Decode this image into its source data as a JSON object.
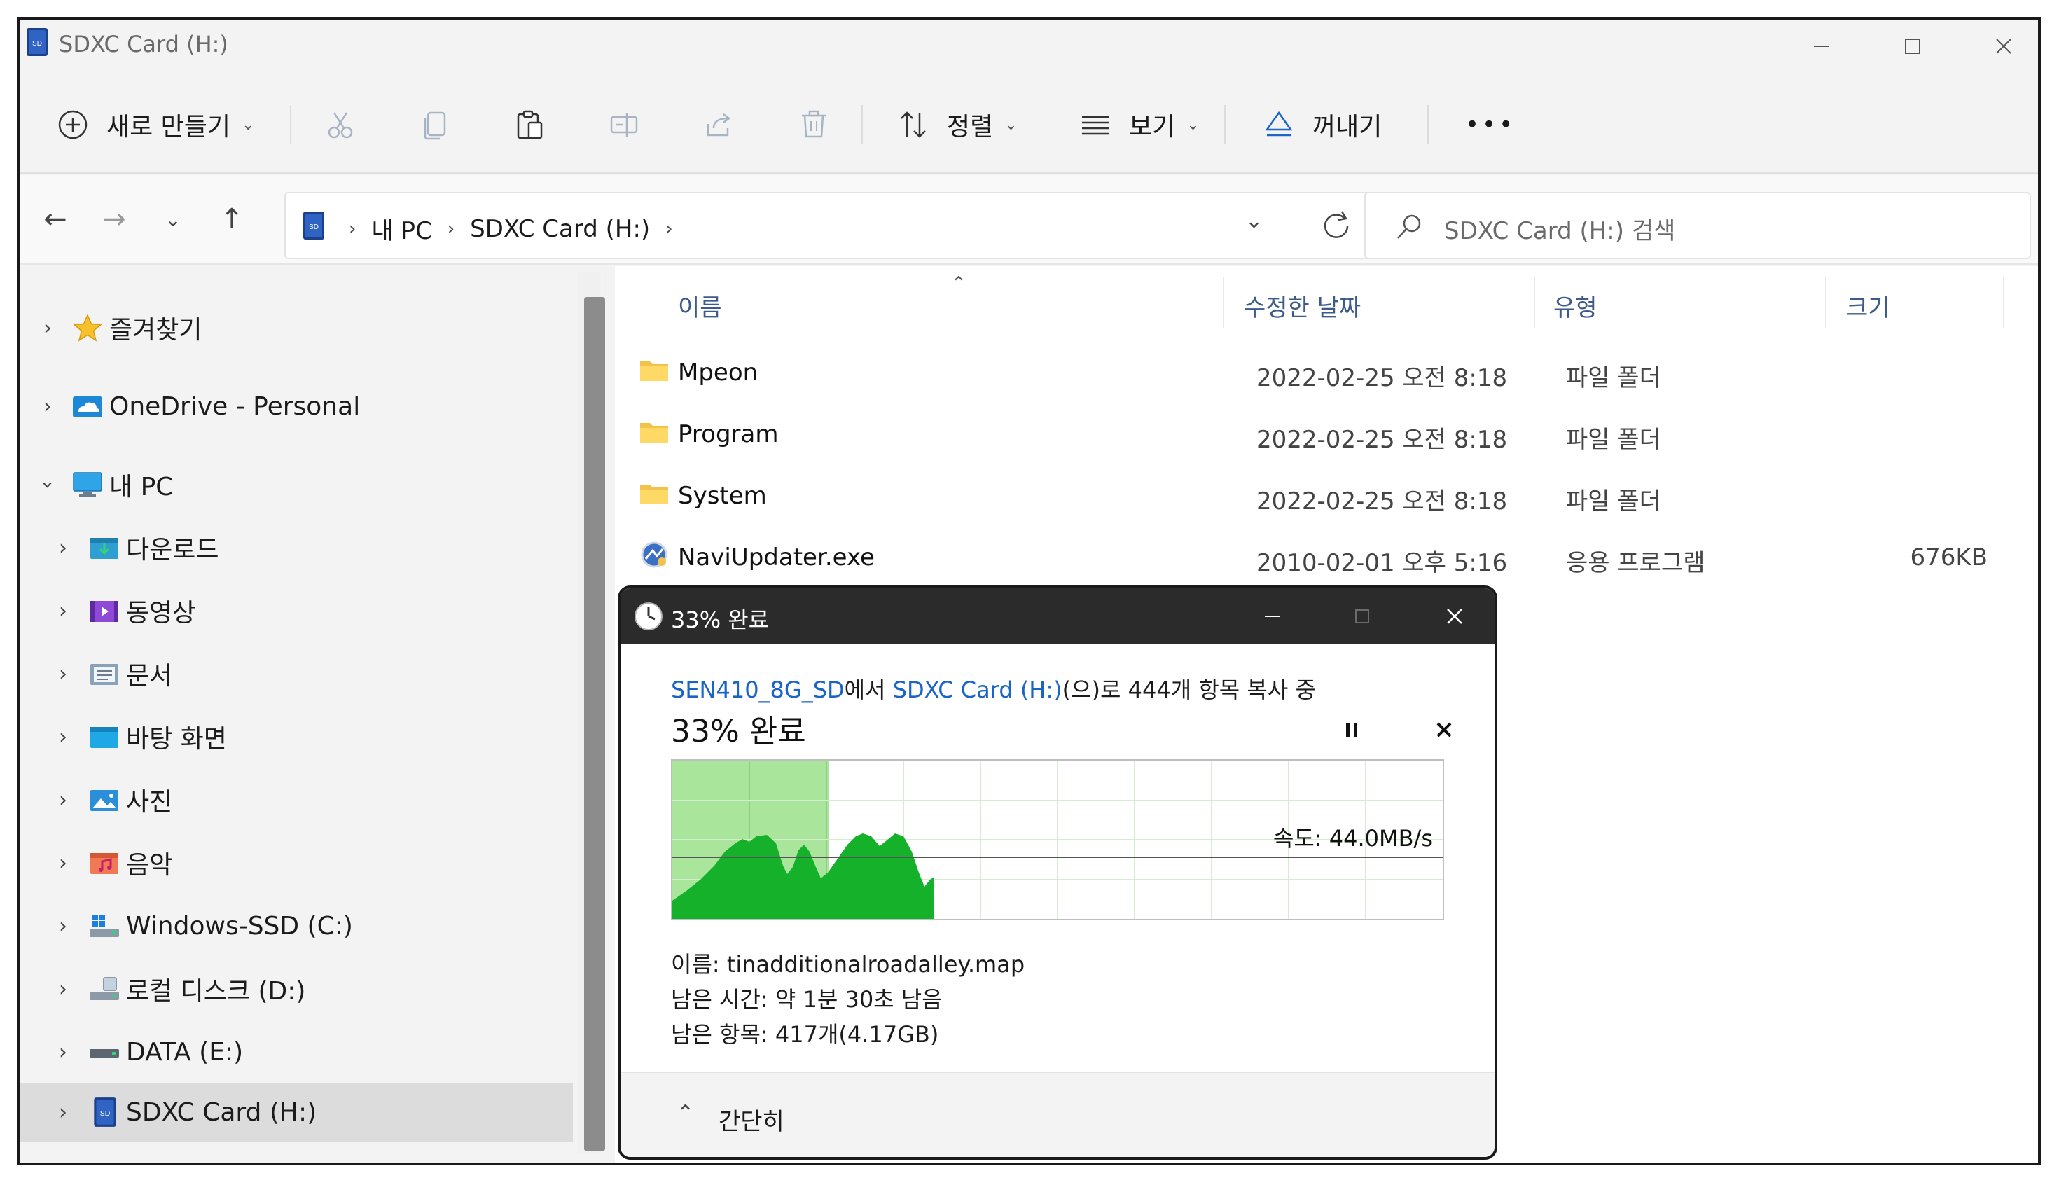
{
  "window": {
    "title": "SDXC Card (H:)"
  },
  "toolbar": {
    "new_label": "새로 만들기",
    "sort_label": "정렬",
    "view_label": "보기",
    "eject_label": "꺼내기",
    "more_label": "•••"
  },
  "address": {
    "crumbs": [
      "내 PC",
      "SDXC Card (H:)"
    ],
    "search_placeholder": "SDXC Card (H:) 검색"
  },
  "sidebar": {
    "items": [
      {
        "label": "즐겨찾기",
        "icon": "star-icon"
      },
      {
        "label": "OneDrive - Personal",
        "icon": "onedrive-icon"
      },
      {
        "label": "내 PC",
        "icon": "computer-icon"
      },
      {
        "label": "다운로드",
        "icon": "downloads-icon"
      },
      {
        "label": "동영상",
        "icon": "videos-icon"
      },
      {
        "label": "문서",
        "icon": "documents-icon"
      },
      {
        "label": "바탕 화면",
        "icon": "desktop-icon"
      },
      {
        "label": "사진",
        "icon": "pictures-icon"
      },
      {
        "label": "음악",
        "icon": "music-icon"
      },
      {
        "label": "Windows-SSD (C:)",
        "icon": "windows-drive-icon"
      },
      {
        "label": "로컬 디스크 (D:)",
        "icon": "local-disk-icon"
      },
      {
        "label": "DATA (E:)",
        "icon": "drive-icon"
      },
      {
        "label": "SDXC Card (H:)",
        "icon": "sd-card-icon"
      }
    ]
  },
  "columns": {
    "name": "이름",
    "modified": "수정한 날짜",
    "type": "유형",
    "size": "크기"
  },
  "files": [
    {
      "name": "Mpeon",
      "modified": "2022-02-25 오전 8:18",
      "type": "파일 폴더",
      "size": ""
    },
    {
      "name": "Program",
      "modified": "2022-02-25 오전 8:18",
      "type": "파일 폴더",
      "size": ""
    },
    {
      "name": "System",
      "modified": "2022-02-25 오전 8:18",
      "type": "파일 폴더",
      "size": ""
    },
    {
      "name": "NaviUpdater.exe",
      "modified": "2010-02-01 오후 5:16",
      "type": "응용 프로그램",
      "size": "676KB"
    }
  ],
  "copy_dialog": {
    "title": "33% 완료",
    "source": "SEN410_8G_SD",
    "source_suffix": "에서 ",
    "dest": "SDXC Card (H:)",
    "dest_suffix": "(으)로 444개 항목 복사 중",
    "percent_label": "33% 완료",
    "progress": 0.33,
    "speed_label": "속도: 44.0MB/s",
    "name_line": "이름: tinadditionalroadalley.map",
    "time_line": "남은 시간: 약 1분 30초 남음",
    "items_line": "남은 항목: 417개(4.17GB)",
    "collapse_label": "간단히"
  }
}
